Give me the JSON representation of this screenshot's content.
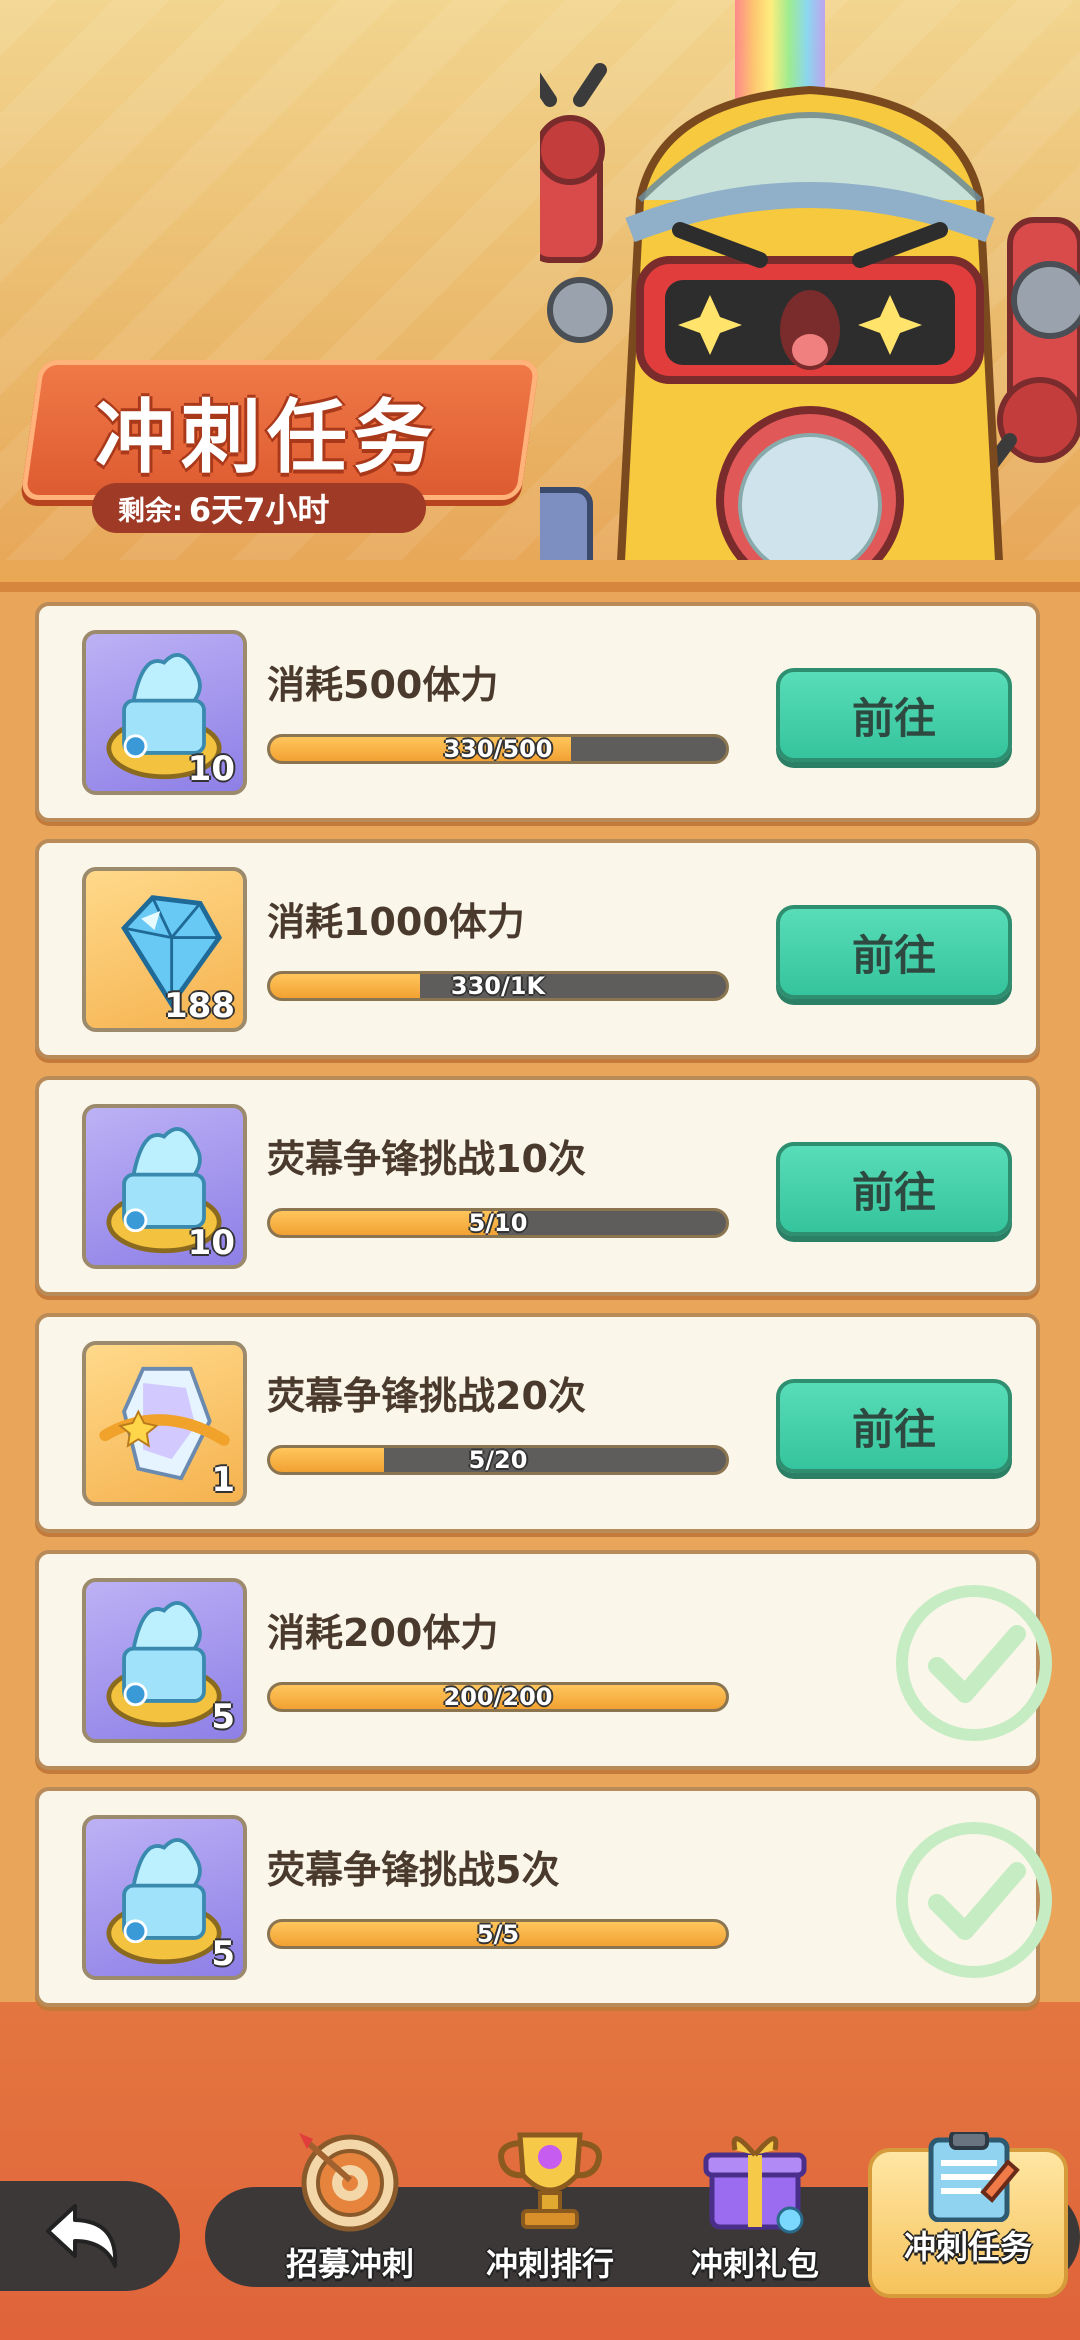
{
  "header": {
    "title": "冲刺任务",
    "timer_label": "剩余:",
    "timer_value": "6天7小时"
  },
  "tasks": [
    {
      "title": "消耗500体力",
      "progress_text": "330/500",
      "progress": 0.66,
      "reward_type": "purple",
      "reward_count": "10",
      "action_label": "前往",
      "done": false
    },
    {
      "title": "消耗1000体力",
      "progress_text": "330/1K",
      "progress": 0.33,
      "reward_type": "gold",
      "reward_count": "188",
      "action_label": "前往",
      "done": false
    },
    {
      "title": "荧幕争锋挑战10次",
      "progress_text": "5/10",
      "progress": 0.5,
      "reward_type": "purple",
      "reward_count": "10",
      "action_label": "前往",
      "done": false
    },
    {
      "title": "荧幕争锋挑战20次",
      "progress_text": "5/20",
      "progress": 0.25,
      "reward_type": "gold-crystal",
      "reward_count": "1",
      "action_label": "前往",
      "done": false
    },
    {
      "title": "消耗200体力",
      "progress_text": "200/200",
      "progress": 1.0,
      "reward_type": "purple",
      "reward_count": "5",
      "action_label": "",
      "done": true
    },
    {
      "title": "荧幕争锋挑战5次",
      "progress_text": "5/5",
      "progress": 1.0,
      "reward_type": "purple",
      "reward_count": "5",
      "action_label": "",
      "done": true
    }
  ],
  "nav": {
    "items": [
      {
        "label": "招募冲刺",
        "icon": "target-icon"
      },
      {
        "label": "冲刺排行",
        "icon": "trophy-icon"
      },
      {
        "label": "冲刺礼包",
        "icon": "gift-icon"
      },
      {
        "label": "冲刺任务",
        "icon": "clipboard-icon"
      }
    ],
    "active_index": 3
  },
  "colors": {
    "accent_green": "#35c49d",
    "banner_orange": "#dd5a30",
    "progress_fill": "#f2a132"
  }
}
